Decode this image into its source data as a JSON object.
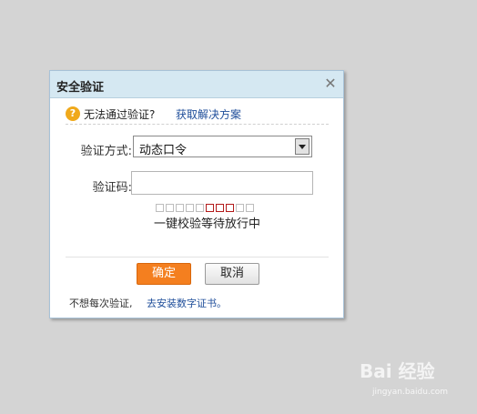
{
  "dialog": {
    "title": "安全验证",
    "close_glyph": "✕",
    "help": {
      "icon": "question-icon",
      "icon_glyph": "?",
      "text": "无法通过验证?",
      "link": "获取解决方案"
    },
    "form": {
      "method_label": "验证方式:",
      "method_value": "动态口令",
      "code_label": "验证码:",
      "code_value": "",
      "progress_total": 10,
      "progress_active": [
        5,
        6,
        7
      ],
      "status_text": "一键校验等待放行中"
    },
    "buttons": {
      "ok_label": "确定",
      "cancel_label": "取消"
    },
    "footer": {
      "text": "不想每次验证,",
      "link": "去安装数字证书。"
    }
  },
  "watermark": {
    "brand": "Bai 经验",
    "url": "jingyan.baidu.com"
  },
  "colors": {
    "background": "#d4d4d4",
    "titlebar": "#d5e8f2",
    "link": "#1f4e9a",
    "ok_button": "#f47f1f",
    "help_icon": "#f0a91b",
    "progress_active": "#b31b1b"
  }
}
